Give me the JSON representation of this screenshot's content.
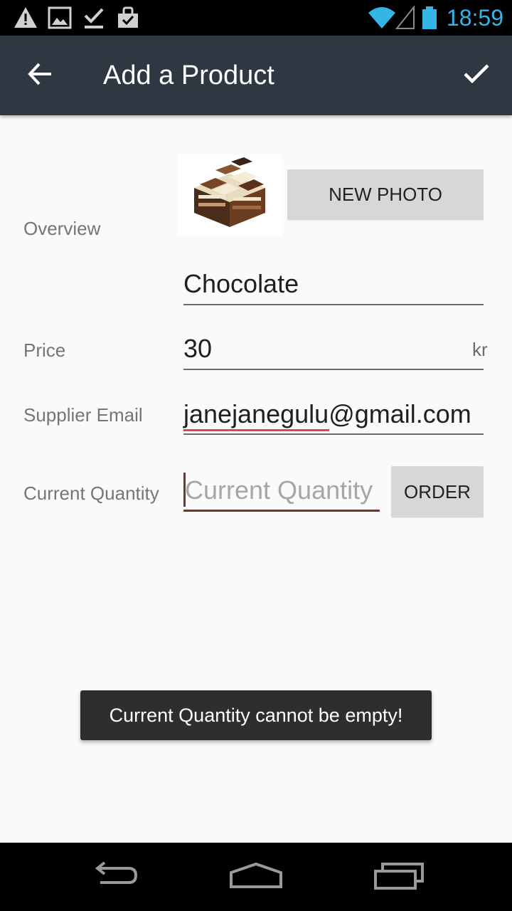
{
  "status_bar": {
    "time": "18:59",
    "icons": [
      "warning-icon",
      "image-icon",
      "download-done-icon",
      "shopping-bag-icon",
      "wifi-icon",
      "signal-icon",
      "battery-icon"
    ],
    "accent_color": "#33b5e5"
  },
  "app_bar": {
    "title": "Add a Product",
    "back_icon": "arrow-back-icon",
    "save_icon": "check-icon",
    "background": "#2f3742"
  },
  "form": {
    "overview_label": "Overview",
    "photo_alt": "chocolate-photo",
    "new_photo_label": "NEW PHOTO",
    "name_value": "Chocolate",
    "price_label": "Price",
    "price_value": "30",
    "price_unit": "kr",
    "email_label": "Supplier Email",
    "email_value": "janejanegulu@gmail.com",
    "quantity_label": "Current Quantity",
    "quantity_placeholder": "Current Quantity",
    "quantity_value": "",
    "order_label": "ORDER"
  },
  "toast": {
    "message": "Current Quantity cannot be empty!"
  },
  "nav_bar": {
    "buttons": [
      "back-nav-icon",
      "home-nav-icon",
      "recents-nav-icon"
    ]
  }
}
